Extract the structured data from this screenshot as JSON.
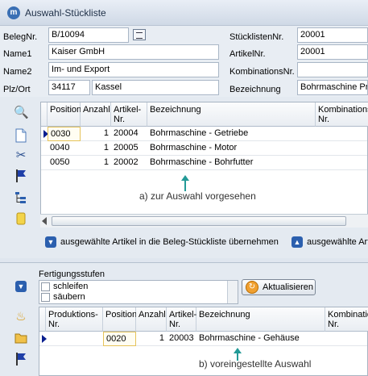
{
  "window": {
    "title": "Auswahl-Stückliste",
    "icon": "app-logo-icon"
  },
  "header": {
    "belegnr": {
      "label": "BelegNr.",
      "value": "B/10094"
    },
    "name1": {
      "label": "Name1",
      "value": "Kaiser GmbH"
    },
    "name2": {
      "label": "Name2",
      "value": "Im- und Export"
    },
    "plz_ort": {
      "label": "Plz/Ort",
      "plz": "34117",
      "ort": "Kassel"
    },
    "stuecklistennr": {
      "label": "StücklistenNr.",
      "value": "20001"
    },
    "artikelnr": {
      "label": "ArtikelNr.",
      "value": "20001"
    },
    "kombinationsnr": {
      "label": "KombinationsNr.",
      "value": ""
    },
    "bezeichnung": {
      "label": "Bezeichnung",
      "value": "Bohrmaschine Pro"
    }
  },
  "grid1": {
    "columns": [
      "Position",
      "Anzahl",
      "Artikel-\nNr.",
      "Bezeichnung",
      "Kombinations\nNr."
    ],
    "rows": [
      {
        "position": "0030",
        "anzahl": "1",
        "artikel": "20004",
        "bezeichnung": "Bohrmaschine - Getriebe",
        "kombination": ""
      },
      {
        "position": "0040",
        "anzahl": "1",
        "artikel": "20005",
        "bezeichnung": "Bohrmaschine - Motor",
        "kombination": ""
      },
      {
        "position": "0050",
        "anzahl": "1",
        "artikel": "20002",
        "bezeichnung": "Bohrmaschine - Bohrfutter",
        "kombination": ""
      }
    ],
    "annotation": "a)  zur Auswahl vorgesehen"
  },
  "actions": {
    "transfer_selected": "ausgewählte Artikel in die Beleg-Stückliste übernehmen",
    "transfer_selected_2": "ausgewählte Arti"
  },
  "fertigung": {
    "label": "Fertigungsstufen",
    "options": [
      "schleifen",
      "säubern"
    ],
    "update_button": "Aktualisieren"
  },
  "grid2": {
    "columns": [
      "Produktions-\nNr.",
      "Position",
      "Anzahl",
      "Artikel-\nNr.",
      "Bezeichnung",
      "Kombination\nNr."
    ],
    "rows": [
      {
        "produktion": "",
        "position": "0020",
        "anzahl": "1",
        "artikel": "20003",
        "bezeichnung": "Bohrmaschine - Gehäuse",
        "kombination": ""
      }
    ],
    "annotation": "b)  voreingestellte Auswahl"
  },
  "colors": {
    "accent": "#2b5fae",
    "annotation_arrow": "#239a97",
    "selection_border": "#e5c35a"
  }
}
